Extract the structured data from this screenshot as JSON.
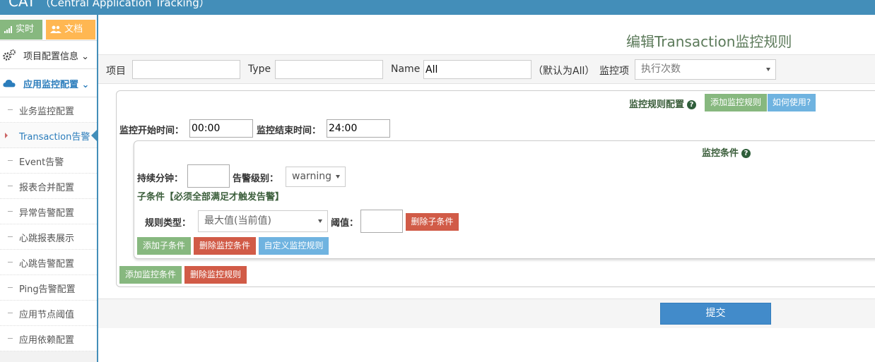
{
  "header": {
    "brand": "CAT",
    "subtitle": "（Central Application Tracking）"
  },
  "sidebar": {
    "realtime_label": "实时",
    "docs_label": "文档",
    "sections": [
      {
        "label": "项目配置信息"
      },
      {
        "label": "应用监控配置"
      }
    ],
    "items": [
      {
        "label": "业务监控配置"
      },
      {
        "label": "Transaction告警"
      },
      {
        "label": "Event告警"
      },
      {
        "label": "报表合并配置"
      },
      {
        "label": "异常告警配置"
      },
      {
        "label": "心跳报表展示"
      },
      {
        "label": "心跳告警配置"
      },
      {
        "label": "Ping告警配置"
      },
      {
        "label": "应用节点阈值"
      },
      {
        "label": "应用依赖配置"
      }
    ]
  },
  "page_title": "编辑Transaction监控规则",
  "filter": {
    "project_label": "项目",
    "project_value": "",
    "type_label": "Type",
    "type_value": "",
    "name_label": "Name",
    "name_value": "All",
    "name_hint": "（默认为All）",
    "metric_label": "监控项",
    "metric_value": "执行次数"
  },
  "rule": {
    "config_title": "监控规则配置",
    "add_rule_btn": "添加监控规则",
    "how_to_btn": "如何使用?",
    "start_label": "监控开始时间：",
    "start_value": "00:00",
    "end_label": "监控结束时间：",
    "end_value": "24:00",
    "condition_title": "监控条件",
    "duration_label": "持续分钟：",
    "duration_value": "",
    "level_label": "告警级别：",
    "level_value": "warning",
    "subcondition_note": "子条件【必须全部满足才触发告警】",
    "rule_type_label": "规则类型：",
    "rule_type_value": "最大值(当前值)",
    "threshold_label": "阈值：",
    "threshold_value": "",
    "delete_sub_btn": "删除子条件",
    "add_sub_btn": "添加子条件",
    "delete_condition_btn": "删除监控条件",
    "custom_rule_btn": "自定义监控规则",
    "add_condition_btn": "添加监控条件",
    "delete_rule_btn": "删除监控规则"
  },
  "submit_label": "提交",
  "colors": {
    "topbar": "#438eb9",
    "green": "#87b87f",
    "blue": "#6fb3e0",
    "red": "#d15b47",
    "primary": "#428bca"
  }
}
